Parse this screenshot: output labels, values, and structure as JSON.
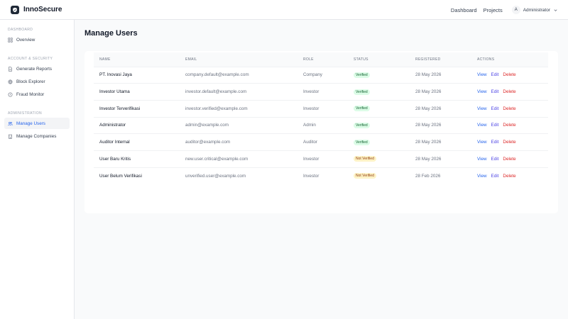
{
  "brand": {
    "name": "InnoSecure"
  },
  "topnav": {
    "links": [
      "Dashboard",
      "Projects"
    ],
    "user_initial": "A",
    "user_name": "Administrator"
  },
  "sidebar": {
    "sections": [
      {
        "title": "DASHBOARD",
        "items": [
          {
            "label": "Overview",
            "icon": "grid-icon"
          }
        ]
      },
      {
        "title": "ACCOUNT & SECURITY",
        "items": [
          {
            "label": "Generate Reports",
            "icon": "document-icon"
          },
          {
            "label": "Block Explorer",
            "icon": "globe-icon"
          },
          {
            "label": "Fraud Monitor",
            "icon": "alert-circle-icon"
          }
        ]
      },
      {
        "title": "ADMINISTRATION",
        "items": [
          {
            "label": "Manage Users",
            "icon": "users-icon",
            "active": true
          },
          {
            "label": "Manage Companies",
            "icon": "building-icon"
          }
        ]
      }
    ]
  },
  "main": {
    "title": "Manage Users",
    "table": {
      "headers": [
        "NAME",
        "EMAIL",
        "ROLE",
        "STATUS",
        "REGISTERED",
        "ACTIONS"
      ],
      "actions": [
        "View",
        "Edit",
        "Delete"
      ],
      "rows": [
        {
          "name": "PT. Inovasi Jaya",
          "email": "company.default@example.com",
          "role": "Company",
          "status": "Verified",
          "registered": "28 May 2026"
        },
        {
          "name": "Investor Utama",
          "email": "investor.default@example.com",
          "role": "Investor",
          "status": "Verified",
          "registered": "28 May 2026"
        },
        {
          "name": "Investor Terverifikasi",
          "email": "investor.verified@example.com",
          "role": "Investor",
          "status": "Verified",
          "registered": "28 May 2026"
        },
        {
          "name": "Administrator",
          "email": "admin@example.com",
          "role": "Admin",
          "status": "Verified",
          "registered": "28 May 2026"
        },
        {
          "name": "Auditor Internal",
          "email": "auditor@example.com",
          "role": "Auditor",
          "status": "Verified",
          "registered": "28 May 2026"
        },
        {
          "name": "User Baru Kritis",
          "email": "new.user.critical@example.com",
          "role": "Investor",
          "status": "Not Verified",
          "registered": "28 May 2026"
        },
        {
          "name": "User Belum Verifikasi",
          "email": "unverified.user@example.com",
          "role": "Investor",
          "status": "Not Verified",
          "registered": "28 Feb 2026"
        }
      ]
    }
  },
  "colors": {
    "accent": "#2563eb",
    "edit": "#4f46e5",
    "delete": "#dc2626",
    "verified_bg": "#dcfce7",
    "not_verified_bg": "#fef3c7"
  }
}
